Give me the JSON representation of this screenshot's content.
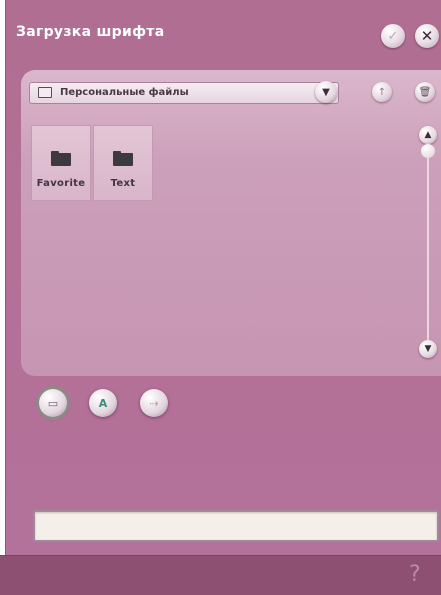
{
  "window": {
    "title": "Загрузка шрифта",
    "ok_icon": "✓",
    "close_icon": "✕"
  },
  "toolbar": {
    "location_label": "Персональные файлы",
    "dropdown_icon": "▼",
    "up_icon": "↑",
    "delete_icon": "🗑"
  },
  "files": [
    {
      "label": "Favorite",
      "type": "folder"
    },
    {
      "label": "Text",
      "type": "folder"
    }
  ],
  "scroll": {
    "up_icon": "▲",
    "down_icon": "▼"
  },
  "modes": [
    {
      "icon": "folder-icon",
      "glyph": "▭",
      "selected": true
    },
    {
      "icon": "font-icon",
      "glyph": "A",
      "selected": false
    },
    {
      "icon": "usb-icon",
      "glyph": "⇢",
      "selected": false
    }
  ],
  "filename_field": {
    "value": ""
  },
  "help": {
    "icon": "?"
  },
  "colors": {
    "window_bg": "#b06e92",
    "panel_bg": "#cc9fba",
    "bottombar_bg": "#8d4f72"
  }
}
